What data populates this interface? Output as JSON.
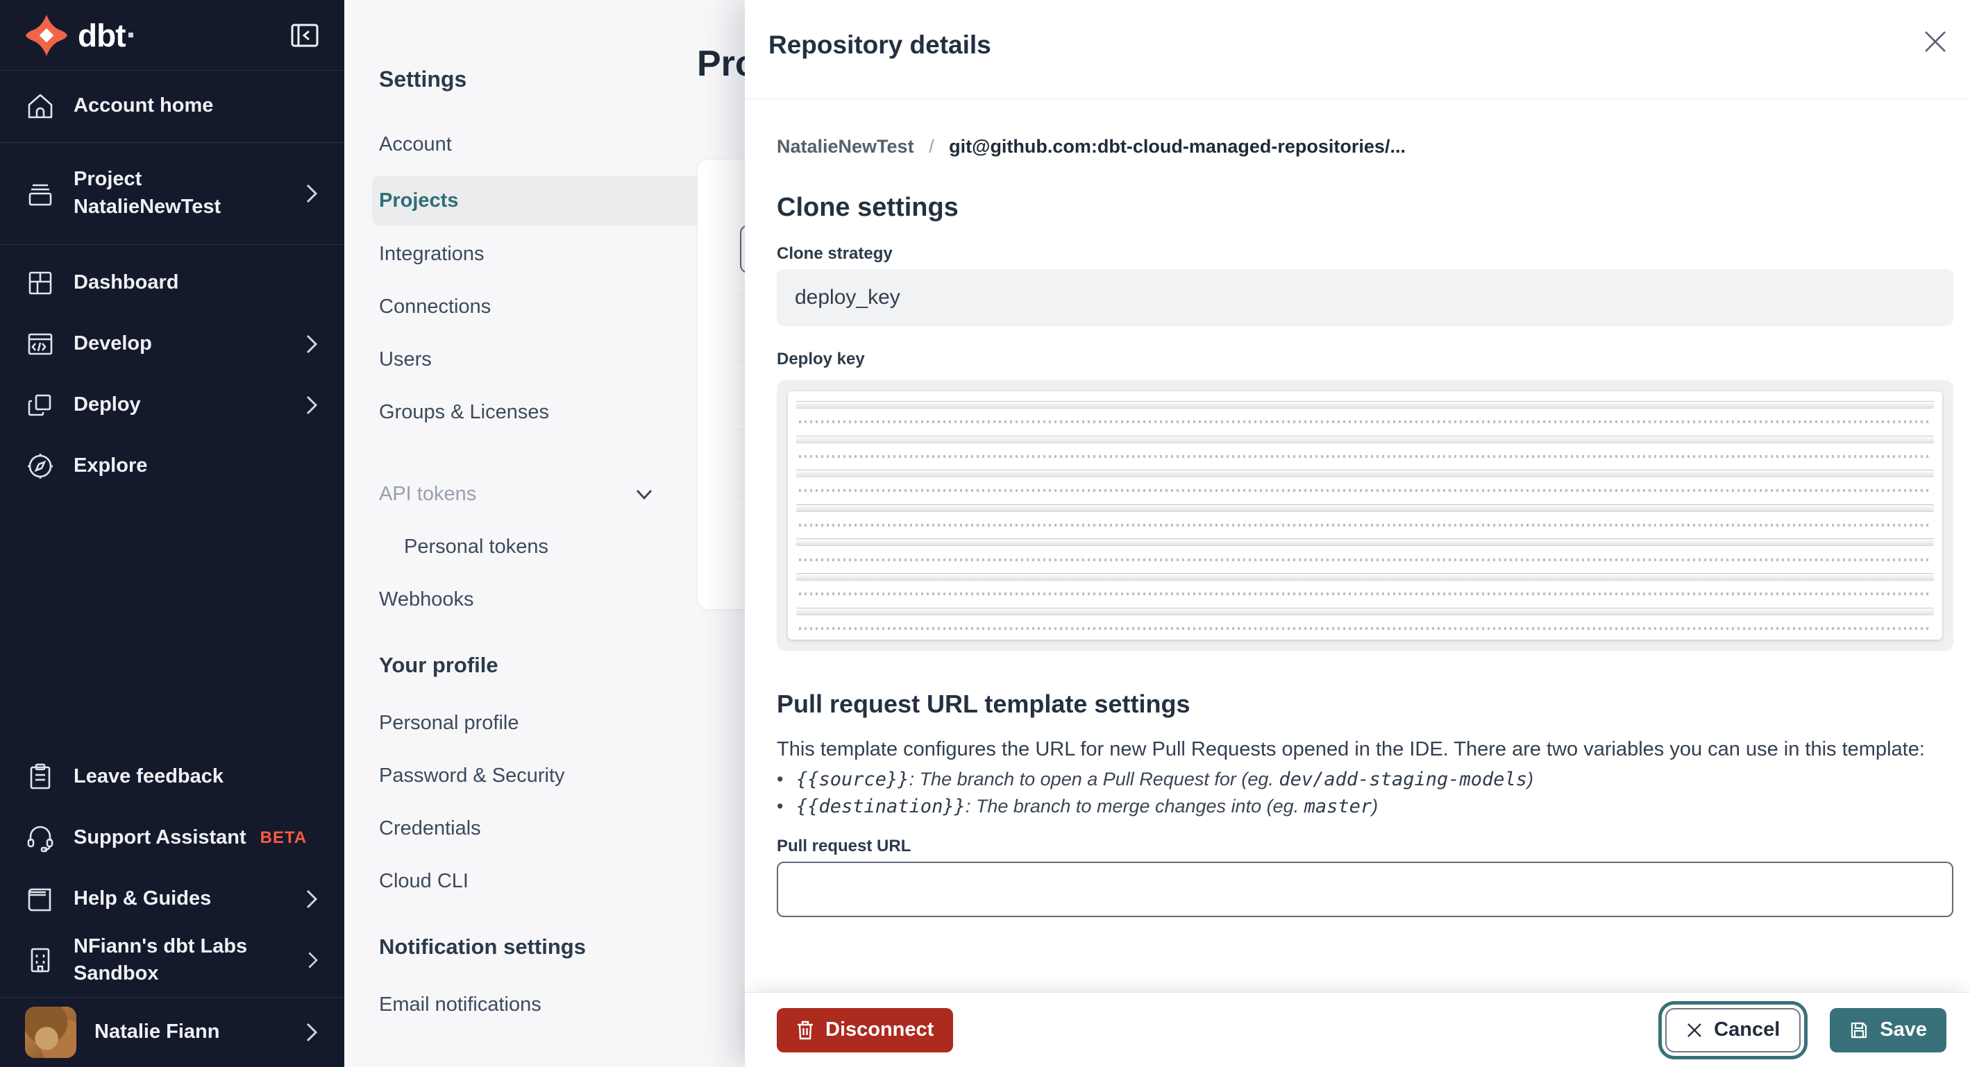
{
  "brand": {
    "logo_text": "dbt"
  },
  "colors": {
    "sidebar_bg": "#141a2b",
    "brand_orange": "#f06549",
    "accent_teal": "#38717a",
    "selected_nav_teal": "#2e6f77",
    "danger_red": "#ad2a1f",
    "beta_orange": "#fb5a3f"
  },
  "icons": {
    "logo": "dbt-pinwheel",
    "collapse": "panel-collapse-left",
    "home": "house",
    "project": "archive-box",
    "dashboard": "grid",
    "develop": "code-window",
    "deploy": "overlapping-squares",
    "explore": "compass",
    "feedback": "clipboard",
    "support": "headset",
    "help": "book",
    "sandbox": "building",
    "chevron_right": "›",
    "chevron_down": "⌄",
    "close": "×",
    "trash": "🗑",
    "save": "💾",
    "cancel_x": "×"
  },
  "sidebar": {
    "items": [
      {
        "label": "Account home"
      },
      {
        "label": "Project",
        "sublabel": "NatalieNewTest"
      },
      {
        "label": "Dashboard"
      },
      {
        "label": "Develop"
      },
      {
        "label": "Deploy"
      },
      {
        "label": "Explore"
      }
    ],
    "footer_items": [
      {
        "label": "Leave feedback"
      },
      {
        "label": "Support Assistant",
        "badge": "BETA"
      },
      {
        "label": "Help & Guides"
      },
      {
        "label": "NFiann's dbt Labs Sandbox"
      }
    ],
    "user": {
      "name": "Natalie Fiann"
    }
  },
  "settings_nav": {
    "title": "Settings",
    "items": [
      "Account",
      "Projects",
      "Integrations",
      "Connections",
      "Users",
      "Groups & Licenses"
    ],
    "api_tokens": "API tokens",
    "personal_tokens": "Personal tokens",
    "webhooks": "Webhooks",
    "profile_title": "Your profile",
    "profile_items": [
      "Personal profile",
      "Password & Security",
      "Credentials",
      "Cloud CLI"
    ],
    "notifications_title": "Notification settings",
    "notifications_items": [
      "Email notifications"
    ]
  },
  "main": {
    "title": "Projects"
  },
  "drawer": {
    "title": "Repository details",
    "breadcrumb": {
      "project": "NatalieNewTest",
      "separator": "/",
      "repo": "git@github.com:dbt-cloud-managed-repositories/..."
    },
    "clone_settings": {
      "title": "Clone settings",
      "strategy_label": "Clone strategy",
      "strategy_value": "deploy_key",
      "deploy_key_label": "Deploy key"
    },
    "pr_template": {
      "title": "Pull request URL template settings",
      "description": "This template configures the URL for new Pull Requests opened in the IDE. There are two variables you can use in this template:",
      "bullets": [
        {
          "code": "{{source}}",
          "desc": ": The branch to open a Pull Request for (eg. ",
          "example": "dev/add-staging-models",
          "suffix": ")"
        },
        {
          "code": "{{destination}}",
          "desc": ": The branch to merge changes into (eg. ",
          "example": "master",
          "suffix": ")"
        }
      ],
      "url_label": "Pull request URL",
      "url_value": ""
    },
    "footer": {
      "disconnect": "Disconnect",
      "cancel": "Cancel",
      "save": "Save"
    }
  }
}
